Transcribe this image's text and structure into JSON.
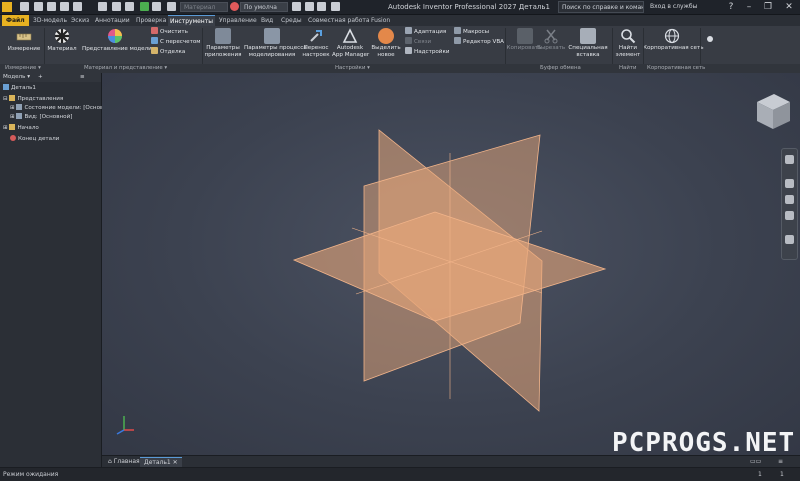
{
  "quick_access": {
    "material_select": "Материал",
    "appearance_select": "По умолча"
  },
  "app_title": "Autodesk Inventor Professional 2027   Деталь1",
  "help_search": "Поиск по справке и командам",
  "sign_in": "Вход в службы",
  "tabs": [
    "Файл",
    "3D-модель",
    "Эскиз",
    "Аннотации",
    "Проверка",
    "Инструменты",
    "Управление",
    "Вид",
    "Среды",
    "Совместная работа",
    "Fusion"
  ],
  "active_tab": "Инструменты",
  "ribbon": {
    "measure": "Измерение",
    "material": "Материал",
    "appearance": "Представление модели",
    "clear": "Очистить",
    "recalc": "С пересчетом",
    "finish": "Отделка",
    "app_options_1": "Параметры",
    "app_options_2": "приложения",
    "doc_settings_1": "Параметры процесса",
    "doc_settings_2": "моделирования",
    "migrate_1": "Перенос",
    "migrate_2": "настроек",
    "app_manager_1": "Autodesk",
    "app_manager_2": "App Manager",
    "whats_new_1": "Выделить",
    "whats_new_2": "новое",
    "adaptation": "Адаптация",
    "link": "Связи",
    "addins": "Надстройки",
    "macros": "Макросы",
    "vba": "Редактор VBA",
    "copy": "Копировать",
    "cut": "Вырезать",
    "paste_special_1": "Специальная",
    "paste_special_2": "вставка",
    "find_1": "Найти",
    "find_2": "элемент",
    "corp_net": "Корпоративная сеть"
  },
  "panels": {
    "measure": "Измерение ▾",
    "material": "Материал и представление ▾",
    "options": "Настройки ▾",
    "clipboard": "Буфер обмена",
    "find": "Найти",
    "corp": "Корпоративная сеть"
  },
  "browser": {
    "tab": "Модель ▾",
    "plus": "+",
    "root": "Деталь1",
    "items": [
      "Представления",
      "Состояние модели: [Основной]",
      "Вид: [Основной]",
      "Начало",
      "Конец детали"
    ]
  },
  "view_tabs": {
    "home": "Главная",
    "part": "Деталь1"
  },
  "status": {
    "text": "Режим ожидания",
    "num1": "1",
    "num2": "1"
  },
  "watermark": "PCPROGS.NET",
  "colors": {
    "plane_fill": "#e8a77a",
    "plane_edge": "#f2b48a",
    "file_tab": "#e8b221"
  }
}
